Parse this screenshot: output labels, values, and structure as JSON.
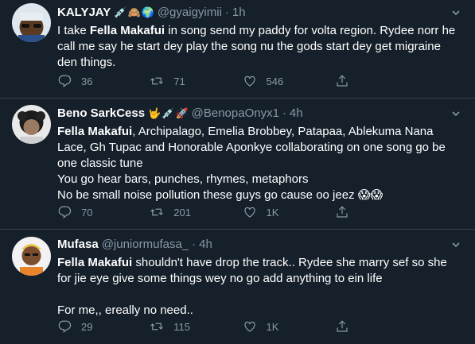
{
  "tweets": [
    {
      "display_name": "KALYJAY",
      "emojis": [
        "💉",
        "🙈",
        "🌍"
      ],
      "handle": "@gyaigyimii",
      "separator": "·",
      "time": "1h",
      "lines": [
        {
          "pre": "I take ",
          "bold": "Fella Makafui",
          "post": " in song send my paddy for volta region. Rydee norr he call me say he start dey play the song nu the gods start dey get migraine den things."
        }
      ],
      "replies": "36",
      "retweets": "71",
      "likes": "546"
    },
    {
      "display_name": "Beno SarkCess",
      "emojis": [
        "🤟",
        "💉",
        "🚀"
      ],
      "handle": "@BenopaOnyx1",
      "separator": "·",
      "time": "4h",
      "lines": [
        {
          "pre": "",
          "bold": "Fella Makafui",
          "post": ", Archipalago, Emelia Brobbey, Patapaa, Ablekuma Nana Lace, Gh Tupac and Honorable Aponkye collaborating on one song go be one classic tune"
        },
        {
          "pre": "You go hear bars, punches, rhymes, metaphors",
          "bold": "",
          "post": ""
        },
        {
          "pre": "No be small noise pollution these guys go cause oo jeez 😱😱",
          "bold": "",
          "post": ""
        }
      ],
      "replies": "70",
      "retweets": "201",
      "likes": "1K"
    },
    {
      "display_name": "Mufasa",
      "emojis": [],
      "handle": "@juniormufasa_",
      "separator": "·",
      "time": "4h",
      "lines": [
        {
          "pre": "",
          "bold": "Fella Makafui",
          "post": " shouldn't have drop the track.. Rydee she marry sef so she for jie eye give some things wey no go add anything to ein life"
        },
        {
          "pre": "",
          "bold": "",
          "post": ""
        },
        {
          "pre": "For me,, ereally no need..",
          "bold": "",
          "post": ""
        }
      ],
      "replies": "29",
      "retweets": "115",
      "likes": "1K"
    }
  ],
  "icons": {
    "reply": "reply-icon",
    "retweet": "retweet-icon",
    "like": "heart-icon",
    "share": "share-icon",
    "more": "chevron-down-icon"
  },
  "colors": {
    "background": "#15202b",
    "text": "#ffffff",
    "secondary": "#8899a6",
    "divider": "#38444d"
  }
}
